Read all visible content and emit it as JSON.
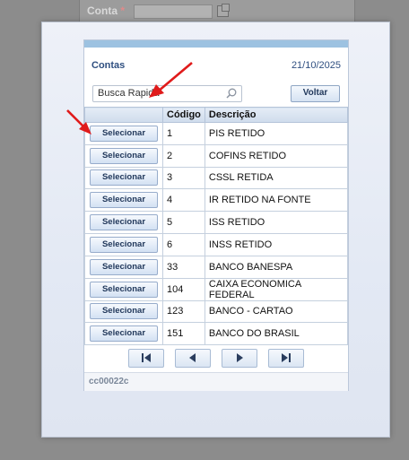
{
  "background": {
    "field_label": "Conta",
    "required_marker": "*"
  },
  "panel": {
    "title": "Contas",
    "date": "21/10/2025",
    "search": {
      "placeholder": "Busca Rapida"
    },
    "back_button": "Voltar",
    "columns": [
      "",
      "Código",
      "Descrição"
    ],
    "select_label": "Selecionar",
    "rows": [
      {
        "code": "1",
        "description": "PIS RETIDO"
      },
      {
        "code": "2",
        "description": "COFINS RETIDO"
      },
      {
        "code": "3",
        "description": "CSSL RETIDA"
      },
      {
        "code": "4",
        "description": "IR RETIDO NA FONTE"
      },
      {
        "code": "5",
        "description": "ISS RETIDO"
      },
      {
        "code": "6",
        "description": "INSS RETIDO"
      },
      {
        "code": "33",
        "description": "BANCO BANESPA"
      },
      {
        "code": "104",
        "description": "CAIXA ECONOMICA FEDERAL"
      },
      {
        "code": "123",
        "description": "BANCO - CARTAO"
      },
      {
        "code": "151",
        "description": "BANCO DO BRASIL"
      }
    ],
    "pager_icons": [
      "first-page-icon",
      "previous-page-icon",
      "next-page-icon",
      "last-page-icon"
    ],
    "footer_code": "cc00022c"
  },
  "colors": {
    "header_blue": "#2f4f80",
    "topbar": "#9dc2e1",
    "annotation_arrow": "#e01b1b"
  }
}
